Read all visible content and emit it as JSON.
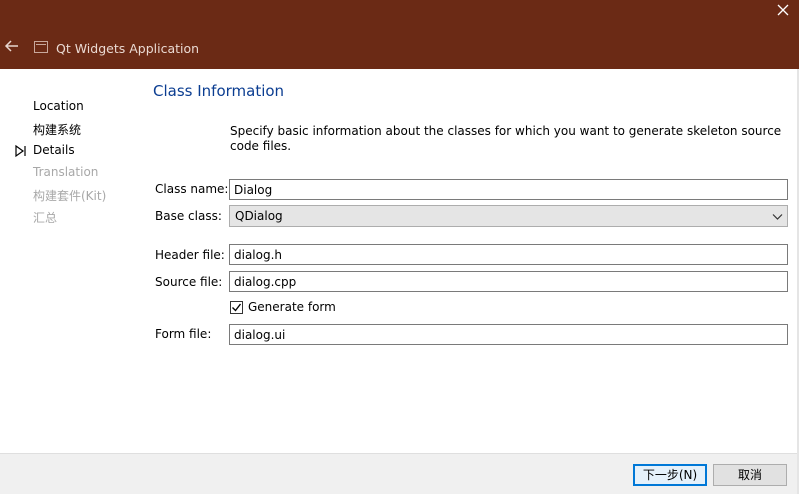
{
  "window": {
    "title": "Qt Widgets Application",
    "accent_color": "#6b2a15"
  },
  "icons": {
    "back": "back-arrow-icon",
    "app": "app-window-icon",
    "close": "close-icon",
    "current_step": "current-step-arrow-icon",
    "dropdown": "chevron-down-icon",
    "checkbox": "checkmark-icon"
  },
  "sidebar": {
    "items": [
      {
        "label": "Location",
        "state": "done"
      },
      {
        "label": "构建系统",
        "state": "done"
      },
      {
        "label": "Details",
        "state": "current"
      },
      {
        "label": "Translation",
        "state": "pending"
      },
      {
        "label": "构建套件(Kit)",
        "state": "pending"
      },
      {
        "label": "汇总",
        "state": "pending"
      }
    ]
  },
  "main": {
    "title": "Class Information",
    "description": "Specify basic information about the classes for which you want to generate skeleton source code files.",
    "class_name": {
      "label": "Class name:",
      "value": "Dialog"
    },
    "base_class": {
      "label": "Base class:",
      "value": "QDialog"
    },
    "header_file": {
      "label": "Header file:",
      "value": "dialog.h"
    },
    "source_file": {
      "label": "Source file:",
      "value": "dialog.cpp"
    },
    "generate_form": {
      "label": "Generate form",
      "checked": true
    },
    "form_file": {
      "label": "Form file:",
      "value": "dialog.ui"
    }
  },
  "footer": {
    "next_label": "下一步(N)",
    "cancel_label": "取消"
  }
}
